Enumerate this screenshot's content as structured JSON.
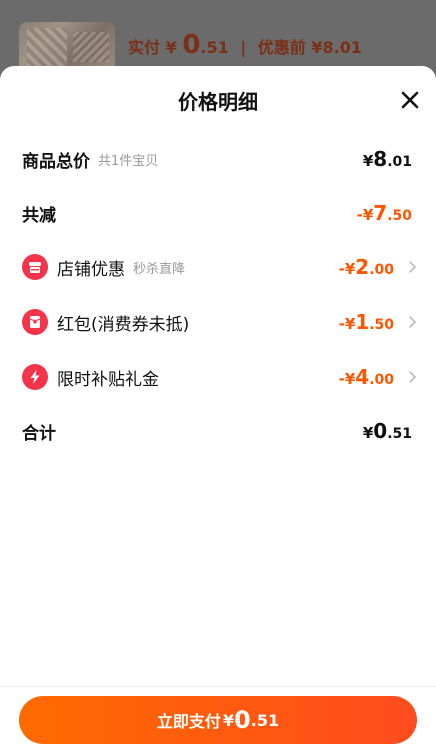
{
  "background_header": {
    "paid_label": "实付",
    "paid_currency": "¥",
    "paid_int": "0",
    "paid_dec": ".51",
    "separator": "|",
    "before_label": "优惠前",
    "before_amount": "¥8.01"
  },
  "sheet": {
    "title": "价格明细",
    "close_icon": "close-icon"
  },
  "rows": {
    "total": {
      "label": "商品总价",
      "sub": "共1件宝贝",
      "currency": "¥",
      "int": "8",
      "dec": ".01"
    },
    "reduce": {
      "label": "共减",
      "prefix": "-¥",
      "int": "7",
      "dec": ".50"
    },
    "shop": {
      "icon": "shop-icon",
      "label": "店铺优惠",
      "sub": "秒杀直降",
      "prefix": "-¥",
      "int": "2",
      "dec": ".00"
    },
    "redpacket": {
      "icon": "red-packet-icon",
      "label": "红包(消费券未抵)",
      "prefix": "-¥",
      "int": "1",
      "dec": ".50"
    },
    "subsidy": {
      "icon": "lightning-icon",
      "label": "限时补贴礼金",
      "prefix": "-¥",
      "int": "4",
      "dec": ".00"
    },
    "sum": {
      "label": "合计",
      "currency": "¥",
      "int": "0",
      "dec": ".51"
    }
  },
  "pay_button": {
    "label": "立即支付",
    "currency": "¥",
    "int": "0",
    "dec": ".51"
  },
  "colors": {
    "accent": "#ff5500",
    "icon_red": "#f3344a",
    "button_start": "#ff6a00",
    "button_end": "#ff4c1e"
  }
}
